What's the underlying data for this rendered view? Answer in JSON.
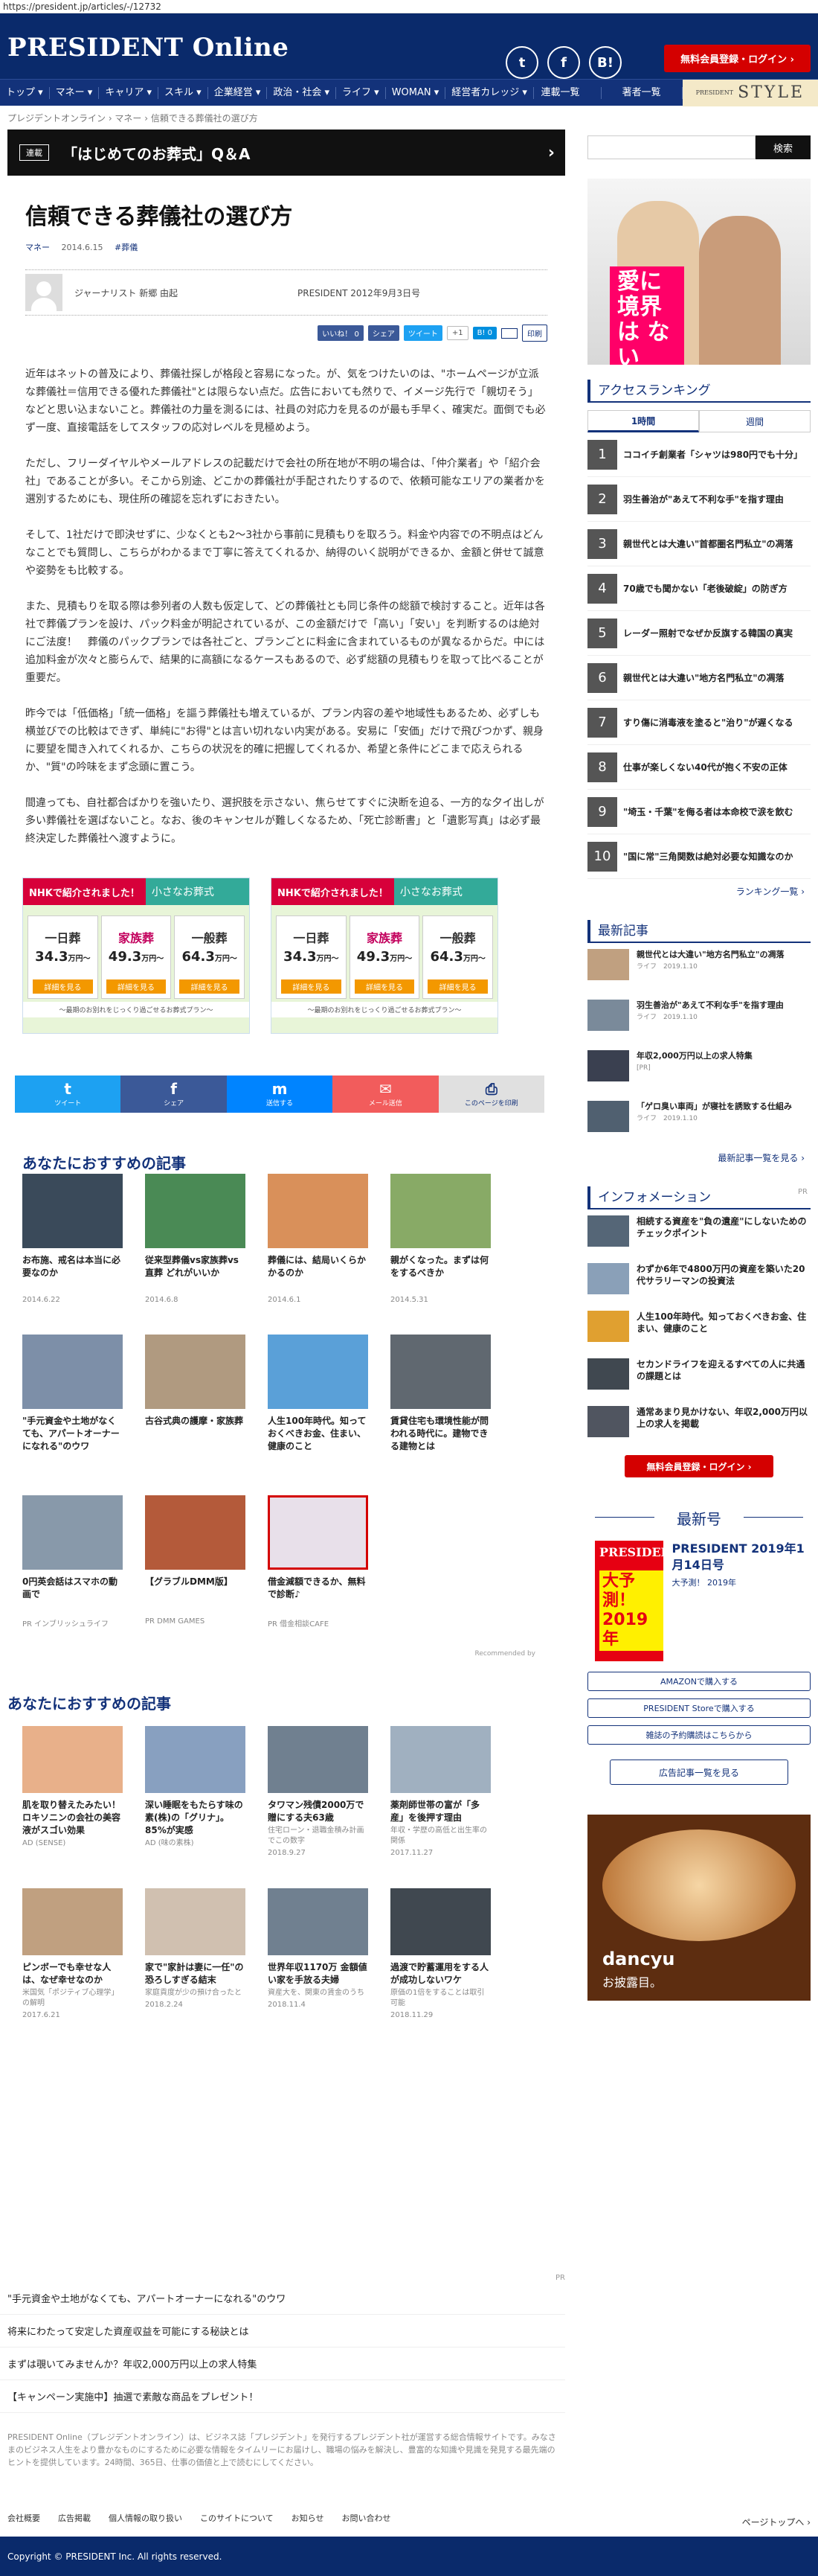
{
  "browser": {
    "url": "https://president.jp/articles/-/12732"
  },
  "header": {
    "logo": "PRESIDENT Online",
    "register_label": "無料会員登録・ログイン ›",
    "social": [
      "t",
      "f",
      "B!"
    ]
  },
  "nav": {
    "items": [
      "トップ ▾",
      "マネー ▾",
      "キャリア ▾",
      "スキル ▾",
      "企業経営 ▾",
      "政治・社会 ▾",
      "ライフ ▾",
      "WOMAN ▾",
      "経営者カレッジ ▾"
    ],
    "right_items": [
      "連載一覧",
      "著者一覧"
    ],
    "style_label": "STYLE",
    "style_prefix": "PRESIDENT"
  },
  "breadcrumb": "プレジデントオンライン  ›  マネー  ›  信頼できる葬儀社の選び方",
  "series": {
    "tag": "連載",
    "title": "「はじめてのお葬式」Q＆A"
  },
  "article": {
    "title": "信頼できる葬儀社の選び方",
    "category": "マネー",
    "date": "2014.6.15",
    "tag": "#葬儀",
    "author": "ジャーナリスト 新郷 由起",
    "source": "PRESIDENT 2012年9月3日号",
    "share": [
      "いいね！ 0",
      "シェア",
      "ツイート",
      "+1",
      "B! 0",
      "印刷"
    ],
    "paragraphs": [
      "近年はネットの普及により、葬儀社探しが格段と容易になった。が、気をつけたいのは、\"ホームページが立派な葬儀社＝信用できる優れた葬儀社\"とは限らない点だ。広告においても然りで、イメージ先行で「親切そう」などと思い込まないこと。葬儀社の力量を測るには、社員の対応力を見るのが最も手早く、確実だ。面倒でも必ず一度、直接電話をしてスタッフの応対レベルを見極めよう。",
      "ただし、フリーダイヤルやメールアドレスの記載だけで会社の所在地が不明の場合は、「仲介業者」や「紹介会社」であることが多い。そこから別途、どこかの葬儀社が手配されたりするので、依頼可能なエリアの業者かを選別するためにも、現住所の確認を忘れずにおきたい。",
      "そして、1社だけで即決せずに、少なくとも2～3社から事前に見積もりを取ろう。料金や内容での不明点はどんなことでも質問し、こちらがわかるまで丁寧に答えてくれるか、納得のいく説明ができるか、金額と併せて誠意や姿勢をも比較する。",
      "また、見積もりを取る際は参列者の人数も仮定して、どの葬儀社とも同じ条件の総額で検討すること。近年は各社で葬儀プランを設け、パック料金が明記されているが、この金額だけで「高い」「安い」を判断するのは絶対にご法度！　葬儀のパックプランでは各社ごと、プランごとに料金に含まれているものが異なるからだ。中には追加料金が次々と膨らんで、結果的に高額になるケースもあるので、必ず総額の見積もりを取って比べることが重要だ。",
      "昨今では「低価格」「統一価格」を謳う葬儀社も増えているが、プラン内容の差や地域性もあるため、必ずしも横並びでの比較はできず、単純に\"お得\"とは言い切れない内実がある。安易に「安価」だけで飛びつかず、親身に要望を聞き入れてくれるか、こちらの状況を的確に把握してくれるか、希望と条件にどこまで応えられるか、\"質\"の吟味をまず念頭に置こう。",
      "間違っても、自社都合ばかりを強いたり、選択肢を示さない、焦らせてすぐに決断を迫る、一方的な夕イ出しが多い葬儀社を選ばないこと。なお、後のキャンセルが難しくなるため、「死亡診断書」と「遺影写真」は必ず最終決定した葬儀社へ渡すように。"
    ]
  },
  "ads": [
    {
      "nhk": "NHKで紹介されました！",
      "brand": "小さなお葬式",
      "plans": [
        {
          "name": "一日葬",
          "price": "34.3",
          "unit": "万円～"
        },
        {
          "name": "家族葬",
          "price": "49.3",
          "unit": "万円～"
        },
        {
          "name": "一般葬",
          "price": "64.3",
          "unit": "万円～"
        }
      ],
      "detail": "詳細を見る",
      "foot": "～最期のお別れをじっくり過ごせるお葬式プラン～"
    },
    {
      "nhk": "NHKで紹介されました！",
      "brand": "小さなお葬式",
      "plans": [
        {
          "name": "一日葬",
          "price": "34.3",
          "unit": "万円～"
        },
        {
          "name": "家族葬",
          "price": "49.3",
          "unit": "万円～"
        },
        {
          "name": "一般葬",
          "price": "64.3",
          "unit": "万円～"
        }
      ],
      "detail": "詳細を見る",
      "foot": "～最期のお別れをじっくり過ごせるお葬式プラン～"
    }
  ],
  "share_big": [
    {
      "icon": "t",
      "label": "ツイート",
      "color": "#1da1f2"
    },
    {
      "icon": "f",
      "label": "シェア",
      "color": "#3b5998"
    },
    {
      "icon": "m",
      "label": "送信する",
      "color": "#0084ff"
    },
    {
      "icon": "✉",
      "label": "メール送信",
      "color": "#f25c5c"
    },
    {
      "icon": "⎙",
      "label": "このページを印刷",
      "color": "#e0e0e0"
    }
  ],
  "recommend1": {
    "title": "あなたにおすすめの記事",
    "items": [
      {
        "title": "お布施、戒名は本当に必要なのか",
        "date": "2014.6.22",
        "pr": "",
        "color": "#3a4a5a"
      },
      {
        "title": "従来型葬儀vs家族葬vs直葬 どれがいいか",
        "date": "2014.6.8",
        "pr": "",
        "color": "#4a8a55"
      },
      {
        "title": "葬儀には、結局いくらかかるのか",
        "date": "2014.6.1",
        "pr": "",
        "color": "#d9905a"
      },
      {
        "title": "親がくなった。まずは何をするべきか",
        "date": "2014.5.31",
        "pr": "",
        "color": "#88aa66"
      },
      {
        "title": "\"手元資金や土地がなくても、アパートオーナーになれる\"のウワ",
        "date": "",
        "pr": "",
        "color": "#7d8fa8"
      },
      {
        "title": "古谷式典の護摩・家族葬",
        "date": "",
        "pr": "",
        "color": "#b09a80"
      },
      {
        "title": "人生100年時代。知っておくべきお金、住まい、健康のこと",
        "date": "",
        "pr": "",
        "color": "#5aa0d8"
      },
      {
        "title": "賃貸住宅も環境性能が問われる時代に。建物できる建物とは",
        "date": "",
        "pr": "",
        "color": "#606870"
      },
      {
        "title": "0円英会話はスマホの動画で",
        "date": "",
        "pr": "PR インブリッシュライフ",
        "color": "#8899aa"
      },
      {
        "title": "【グラブルDMM版】",
        "date": "",
        "pr": "PR DMM GAMES",
        "color": "#b45a3a"
      },
      {
        "title": "借金減額できるか、無料で診断♪",
        "date": "",
        "pr": "PR 借金相談CAFE",
        "color": "#e8e0ea"
      }
    ],
    "recommended_by": "Recommended by"
  },
  "recommend2": {
    "title": "あなたにおすすめの記事",
    "items": [
      {
        "title": "肌を取り替えたみたい！ロキソニンの会社の美容液がスゴい効果",
        "src": "AD (SENSE)",
        "color": "#e8b08a"
      },
      {
        "title": "深い睡眠をもたらす味の素(株)の「グリナ」。85%が実感",
        "src": "AD (味の素株)",
        "color": "#88a0c0"
      },
      {
        "title": "タワマン残債2000万で贈にする夫63歳",
        "src": "住宅ローン・退職金積み計画でこの数字",
        "date": "2018.9.27",
        "color": "#708090"
      },
      {
        "title": "薬剤師世帯の富が「多産」を後押す理由",
        "src": "年収・学歴の高低と出生率の関係",
        "date": "2017.11.27",
        "color": "#a0b0c0"
      },
      {
        "title": "ピンボーでも幸せな人は、なぜ幸せなのか",
        "src": "米国気「ポジティブ心理学」の解明",
        "date": "2017.6.21",
        "color": "#c0a080"
      },
      {
        "title": "家で\"家計は妻に一任\"の恐ろしすぎる結末",
        "src": "家庭貢度が少の預け合ったと",
        "date": "2018.2.24",
        "color": "#d0c0b0"
      },
      {
        "title": "世界年収1170万 金額値い家を手放る夫婦",
        "src": "資産大を、関東の賃金のうち",
        "date": "2018.11.4",
        "color": "#708090"
      },
      {
        "title": "過渡で貯蓄運用をする人が成功しないワケ",
        "src": "原価の1倍をすることは取引可能",
        "date": "2018.11.29",
        "color": "#404850"
      }
    ]
  },
  "sidebar": {
    "search_button": "検索",
    "ad_text": "愛に 境界は ない",
    "ranking_title": "アクセスランキング",
    "tabs": [
      "1時間",
      "週間"
    ],
    "ranking": [
      "ココイチ創業者「シャツは980円でも十分」",
      "羽生善治が\"あえて不利な手\"を指す理由",
      "親世代とは大違い\"首都圏名門私立\"の凋落",
      "70歳でも聞かない「老後破綻」の防ぎ方",
      "レーダー照射でなぜか反旗する韓国の真実",
      "親世代とは大違い\"地方名門私立\"の凋落",
      "すり傷に消毒液を塗ると\"治り\"が遅くなる",
      "仕事が楽しくない40代が抱く不安の正体",
      "\"埼玉・千葉\"を侮る者は本命校で涙を飲む",
      "\"国に常\"三角関数は絶対必要な知識なのか"
    ],
    "ranking_more": "ランキング一覧 ›",
    "latest_title": "最新記事",
    "latest": [
      {
        "title": "親世代とは大違い\"地方名門私立\"の凋落",
        "sub": "ライフ　2019.1.10"
      },
      {
        "title": "羽生善治が\"あえて不利な手\"を指す理由",
        "sub": "ライフ　2019.1.10"
      },
      {
        "title": "年収2,000万円以上の求人特集",
        "sub": "[PR]"
      },
      {
        "title": "「ゲロ臭い車両」が寝社を誘致する仕組み",
        "sub": "ライフ　2019.1.10"
      }
    ],
    "latest_more": "最新記事一覧を見る ›",
    "info_title": "インフォメーション",
    "info_pr": "PR",
    "info": [
      "相続する資産を\"負の遺産\"にしないためのチェックポイント",
      "わずか6年で4800万円の資産を築いた20代サラリーマンの投資法",
      "人生100年時代。知っておくべきお金、住まい、健康のこと",
      "セカンドライフを迎えるすべての人に共通の課題とは",
      "通常あまり見かけない、年収2,000万円以上の求人を掲載"
    ],
    "info_register": "無料会員登録・ログイン ›",
    "latest_issue_title": "最新号",
    "mag_cover_title": "PRESIDENT",
    "mag_cover_banner": "大予測！ 2019年",
    "mag_title": "PRESIDENT 2019年1月14日号",
    "mag_sub": "大予測！ 2019年",
    "buy_buttons": [
      "AMAZONで購入する",
      "PRESIDENT Storeで購入する",
      "雑誌の予約購読はこちらから"
    ],
    "ad_list_button": "広告記事一覧を見る",
    "dancyu_logo": "dancyu",
    "dancyu_sub": "お披露目。"
  },
  "bottom": {
    "pr": "PR",
    "links": [
      "\"手元資金や土地がなくても、アパートオーナーになれる\"のウワ",
      "将来にわたって安定した資産収益を可能にする秘訣とは",
      "まずは覗いてみませんか？年収2,000万円以上の求人特集",
      "【キャンペーン実施中】抽選で素敵な商品をプレゼント！"
    ],
    "description": "PRESIDENT Online（プレジデントオンライン）は、ビジネス誌「プレジデント」を発行するプレジデント社が運営する総合情報サイトです。みなさまのビジネス人生をより豊かなものにするために必要な情報をタイムリーにお届けし、職場の悩みを解決し、豊富的な知識や見識を発見する最先端のヒントを提供しています。24時間、365日、仕事の価値と上で読むにしてください。",
    "footer_links": [
      "会社概要",
      "広告掲載",
      "個人情報の取り扱い",
      "このサイトについて",
      "お知らせ",
      "お問い合わせ"
    ],
    "pagetop": "ページトップへ ›",
    "copyright": "Copyright © PRESIDENT Inc. All rights reserved."
  }
}
